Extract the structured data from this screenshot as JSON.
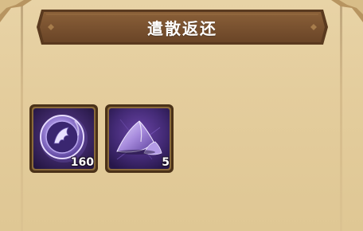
{
  "dialog": {
    "title": "遣散返还"
  },
  "rewards": [
    {
      "icon": "hero-essence-coin-icon",
      "count": "160"
    },
    {
      "icon": "purple-dust-pile-icon",
      "count": "5"
    }
  ],
  "colors": {
    "panel_bg": "#e3cc9c",
    "banner_bg": "#7a5330",
    "slot_purple": "#3a2560",
    "slot_border": "#6b4a2a"
  }
}
